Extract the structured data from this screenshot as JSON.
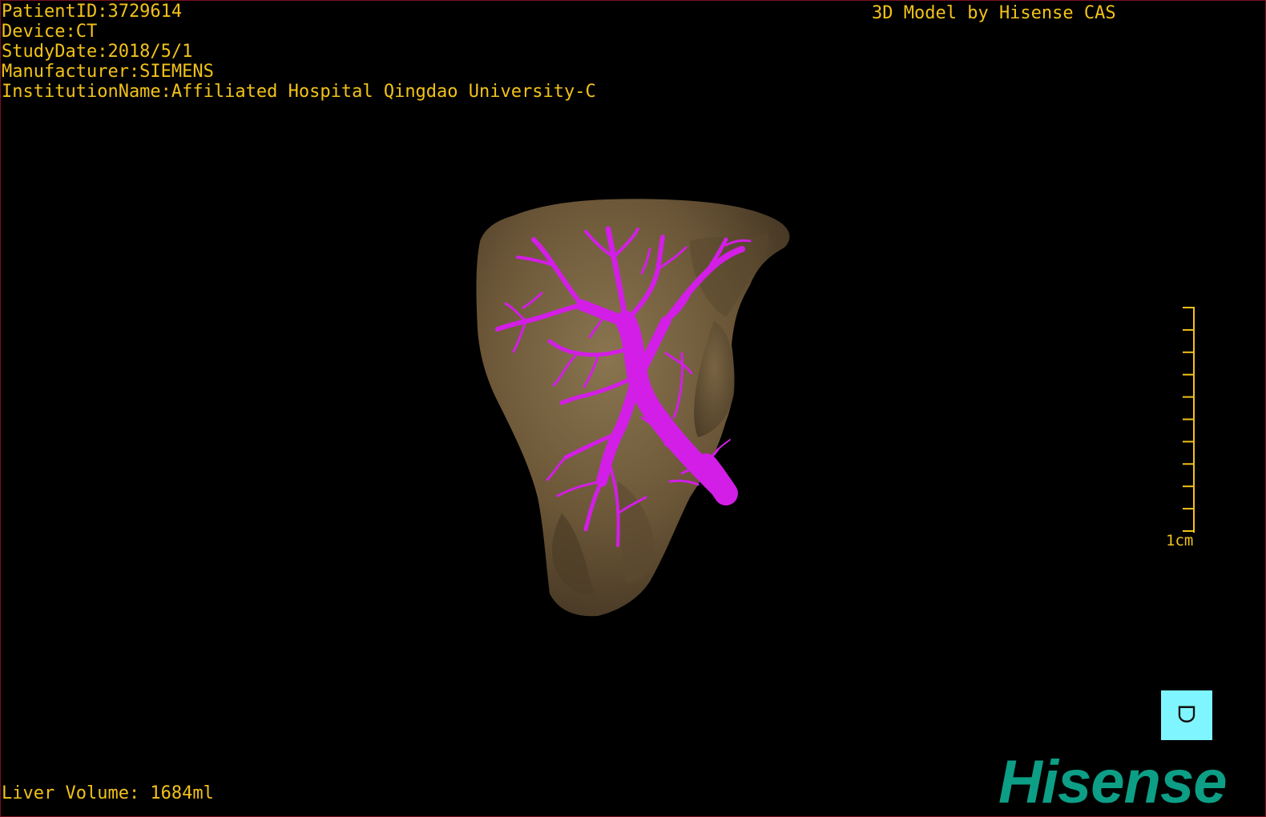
{
  "overlay": {
    "patient_id": "PatientID:3729614",
    "device": "Device:CT",
    "study_date": "StudyDate:2018/5/1",
    "manufacturer": "Manufacturer:SIEMENS",
    "institution": "InstitutionName:Affiliated Hospital Qingdao University-C",
    "credit": "3D Model by Hisense CAS",
    "liver_volume": "Liver Volume: 1684ml"
  },
  "scale_bar": {
    "label": "1cm",
    "tick_count": 11
  },
  "orientation": {
    "glyph": "ᗜ"
  },
  "brand": {
    "logo_text": "Hisense"
  },
  "colors": {
    "overlay_text": "#f2c21a",
    "liver": "#6e5a3a",
    "vessels": "#d21ee6",
    "orientation_cube": "#7ff6ff",
    "brand": "#0d9e86",
    "frame": "#7a1020"
  }
}
